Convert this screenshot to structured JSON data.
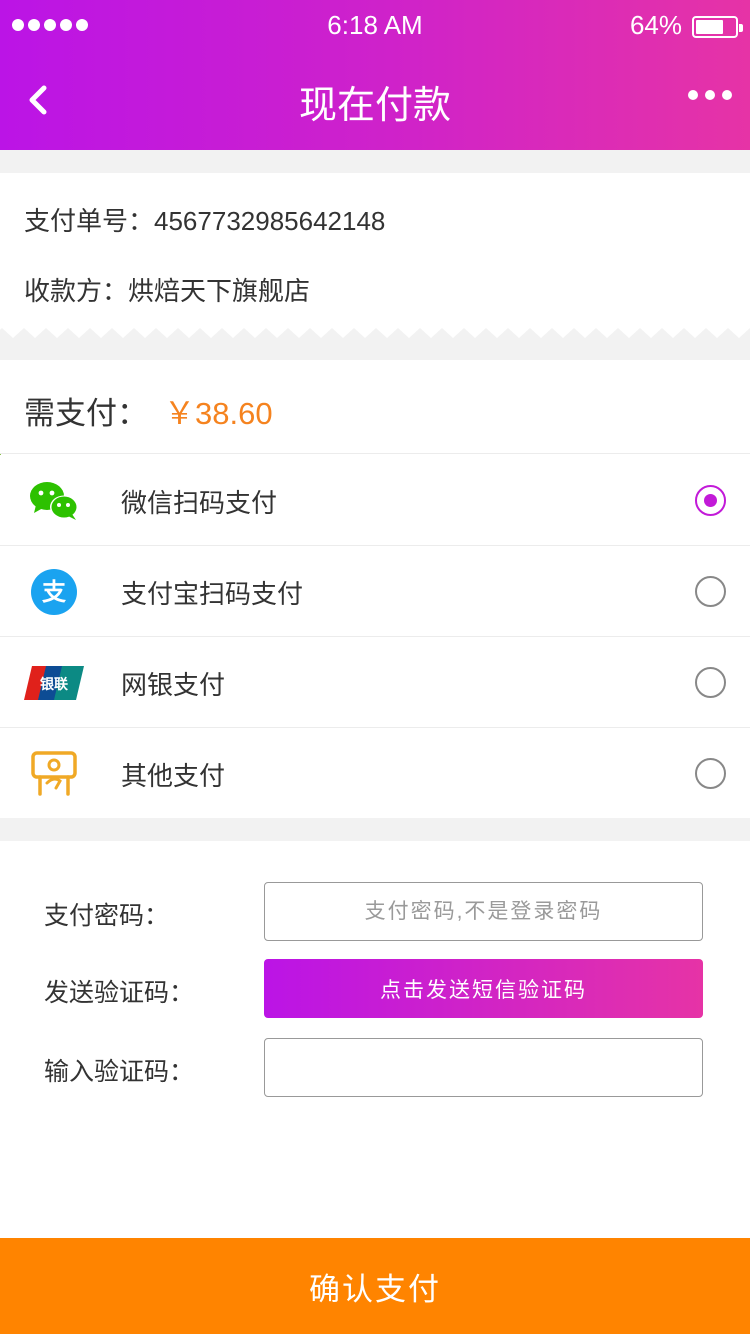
{
  "status_bar": {
    "time": "6:18 AM",
    "battery": "64%"
  },
  "nav": {
    "title": "现在付款",
    "back_icon": "chevron-left-icon",
    "more_icon": "more-dots-icon"
  },
  "order": {
    "number_label": "支付单号：",
    "number_value": "4567732985642148",
    "payee_label": "收款方：",
    "payee_value": "烘焙天下旗舰店"
  },
  "amount": {
    "label": "需支付：",
    "value": "￥38.60",
    "color": "#f5831f"
  },
  "payment_methods": [
    {
      "label": "微信扫码支付",
      "icon": "wechat-icon",
      "selected": true
    },
    {
      "label": "支付宝扫码支付",
      "icon": "alipay-icon",
      "selected": false
    },
    {
      "label": "网银支付",
      "icon": "unionpay-icon",
      "selected": false,
      "icon_text": "银联"
    },
    {
      "label": "其他支付",
      "icon": "cash-hand-icon",
      "selected": false
    }
  ],
  "form": {
    "password_label": "支付密码：",
    "password_placeholder": "支付密码,不是登录密码",
    "send_code_label": "发送验证码：",
    "send_code_button": "点击发送短信验证码",
    "input_code_label": "输入验证码：",
    "input_code_value": ""
  },
  "confirm_button": "确认支付",
  "colors": {
    "brand_gradient_start": "#bb14e6",
    "brand_gradient_end": "#e633a6",
    "confirm": "#ff8400",
    "accent_price": "#f5831f"
  }
}
